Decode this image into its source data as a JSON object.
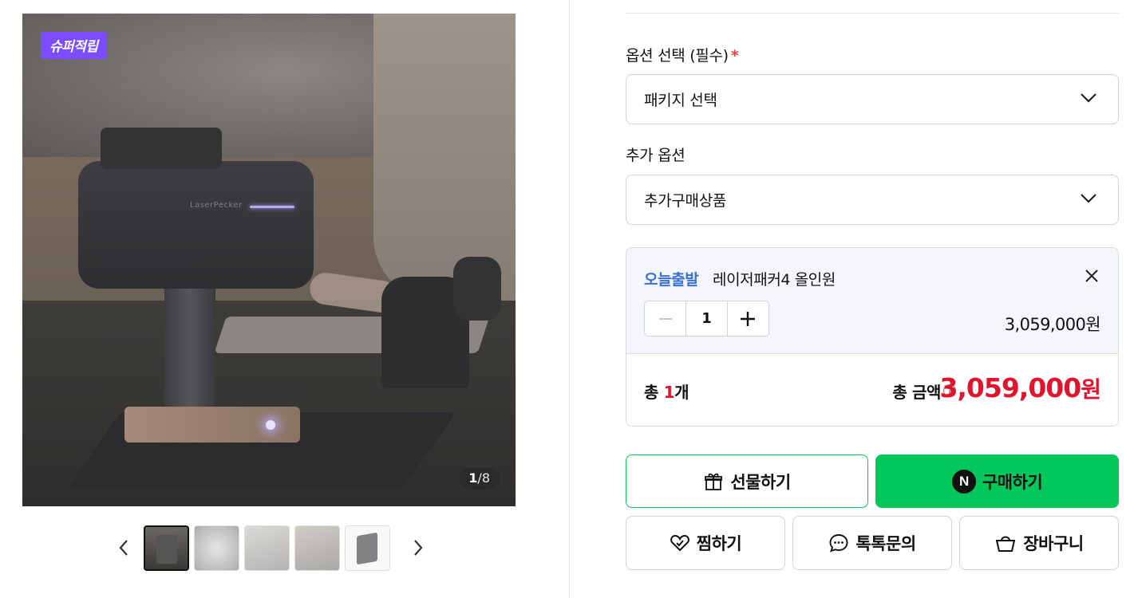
{
  "gallery": {
    "badge": "슈퍼적립",
    "product_logo": "LaserPecker",
    "counter_current": "1",
    "counter_sep": "/",
    "counter_total": "8",
    "prev_icon": "chevron-left-icon",
    "next_icon": "chevron-right-icon"
  },
  "options": {
    "required_label": "옵션 선택 (필수)",
    "required_mark": "*",
    "package_select": "패키지 선택",
    "extra_label": "추가 옵션",
    "extra_select": "추가구매상품"
  },
  "cart": {
    "badge": "오늘출발",
    "item_name": "레이저패커4 올인원",
    "quantity": "1",
    "item_price": "3,059,000원",
    "total_prefix": "총 ",
    "total_count": "1",
    "total_unit": "개",
    "total_label": "총 금액",
    "total_price": "3,059,000",
    "total_won": "원"
  },
  "buttons": {
    "gift": "선물하기",
    "buy": "구매하기",
    "npay_mark": "N",
    "wish": "찜하기",
    "talk": "톡톡문의",
    "cart": "장바구니"
  },
  "colors": {
    "brand_green": "#03c75a",
    "price_red": "#e0142c",
    "badge_purple": "#7b4dff",
    "today_blue": "#3b6fd8"
  }
}
